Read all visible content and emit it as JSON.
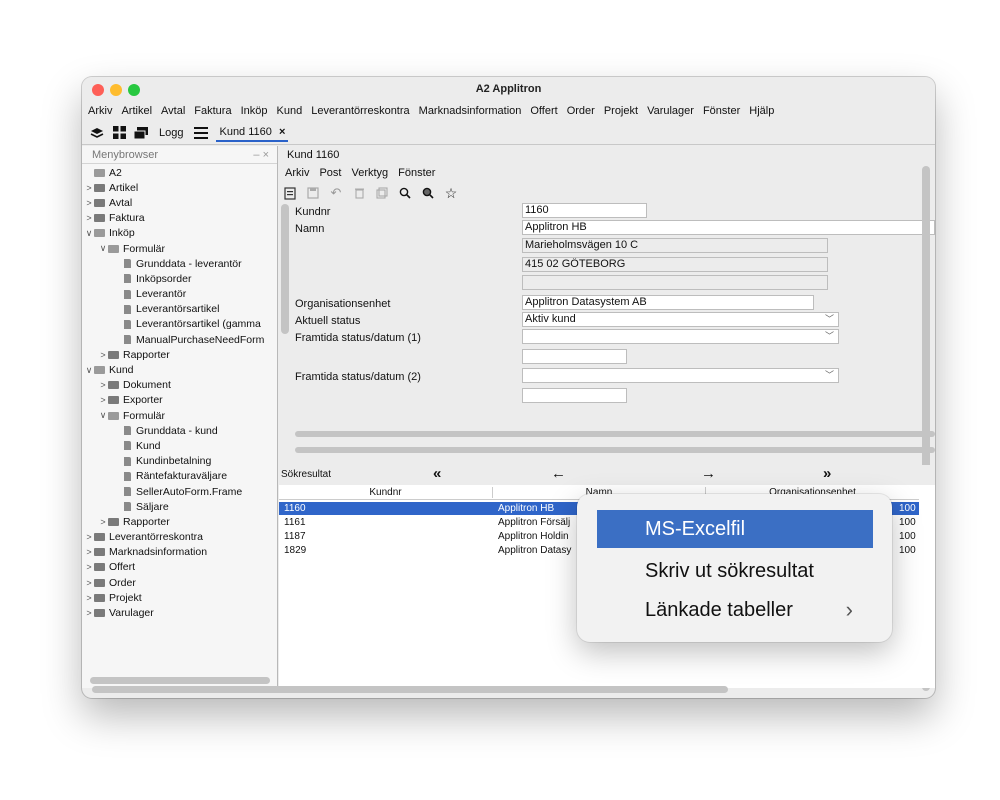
{
  "window": {
    "title": "A2 Applitron"
  },
  "menubar": [
    "Arkiv",
    "Artikel",
    "Avtal",
    "Faktura",
    "Inköp",
    "Kund",
    "Leverantörreskontra",
    "Marknadsinformation",
    "Offert",
    "Order",
    "Projekt",
    "Varulager",
    "Fönster",
    "Hjälp"
  ],
  "toolbar": {
    "tab_logg": "Logg",
    "tab_kund": "Kund 1160",
    "close": "×"
  },
  "sidebar": {
    "title": "Menybrowser",
    "controls": "–  ×",
    "items": [
      {
        "level": 0,
        "type": "folder-open",
        "chev": "",
        "label": "A2"
      },
      {
        "level": 0,
        "type": "folder",
        "chev": ">",
        "label": "Artikel"
      },
      {
        "level": 0,
        "type": "folder",
        "chev": ">",
        "label": "Avtal"
      },
      {
        "level": 0,
        "type": "folder",
        "chev": ">",
        "label": "Faktura"
      },
      {
        "level": 0,
        "type": "folder-open",
        "chev": "∨",
        "label": "Inköp"
      },
      {
        "level": 1,
        "type": "folder-open",
        "chev": "∨",
        "label": "Formulär"
      },
      {
        "level": 2,
        "type": "doc",
        "chev": "",
        "label": "Grunddata - leverantör"
      },
      {
        "level": 2,
        "type": "doc",
        "chev": "",
        "label": "Inköpsorder"
      },
      {
        "level": 2,
        "type": "doc",
        "chev": "",
        "label": "Leverantör"
      },
      {
        "level": 2,
        "type": "doc",
        "chev": "",
        "label": "Leverantörsartikel"
      },
      {
        "level": 2,
        "type": "doc",
        "chev": "",
        "label": "Leverantörsartikel (gamma"
      },
      {
        "level": 2,
        "type": "doc",
        "chev": "",
        "label": "ManualPurchaseNeedForm"
      },
      {
        "level": 1,
        "type": "folder",
        "chev": ">",
        "label": "Rapporter"
      },
      {
        "level": 0,
        "type": "folder-open",
        "chev": "∨",
        "label": "Kund"
      },
      {
        "level": 1,
        "type": "folder",
        "chev": ">",
        "label": "Dokument"
      },
      {
        "level": 1,
        "type": "folder",
        "chev": ">",
        "label": "Exporter"
      },
      {
        "level": 1,
        "type": "folder-open",
        "chev": "∨",
        "label": "Formulär"
      },
      {
        "level": 2,
        "type": "doc",
        "chev": "",
        "label": "Grunddata - kund"
      },
      {
        "level": 2,
        "type": "doc",
        "chev": "",
        "label": "Kund"
      },
      {
        "level": 2,
        "type": "doc",
        "chev": "",
        "label": "Kundinbetalning"
      },
      {
        "level": 2,
        "type": "doc",
        "chev": "",
        "label": "Räntefakturaväljare"
      },
      {
        "level": 2,
        "type": "doc",
        "chev": "",
        "label": "SellerAutoForm.Frame"
      },
      {
        "level": 2,
        "type": "doc",
        "chev": "",
        "label": "Säljare"
      },
      {
        "level": 1,
        "type": "folder",
        "chev": ">",
        "label": "Rapporter"
      },
      {
        "level": 0,
        "type": "folder",
        "chev": ">",
        "label": "Leverantörreskontra"
      },
      {
        "level": 0,
        "type": "folder",
        "chev": ">",
        "label": "Marknadsinformation"
      },
      {
        "level": 0,
        "type": "folder",
        "chev": ">",
        "label": "Offert"
      },
      {
        "level": 0,
        "type": "folder",
        "chev": ">",
        "label": "Order"
      },
      {
        "level": 0,
        "type": "folder",
        "chev": ">",
        "label": "Projekt"
      },
      {
        "level": 0,
        "type": "folder",
        "chev": ">",
        "label": "Varulager"
      }
    ]
  },
  "form": {
    "title": "Kund 1160",
    "menu": [
      "Arkiv",
      "Post",
      "Verktyg",
      "Fönster"
    ],
    "labels": {
      "kundnr": "Kundnr",
      "namn": "Namn",
      "org": "Organisationsenhet",
      "status": "Aktuell status",
      "framtida1": "Framtida status/datum (1)",
      "framtida2": "Framtida status/datum (2)"
    },
    "values": {
      "kundnr": "1160",
      "namn": "Applitron HB",
      "adress1": "Marieholmsvägen 10 C",
      "adress2": "415 02  GÖTEBORG",
      "adress3": "",
      "org": "Applitron Datasystem AB",
      "status": "Aktiv kund",
      "framtida1": "",
      "framtida1_datum": "",
      "framtida2": "",
      "framtida2_datum": ""
    }
  },
  "results": {
    "title": "Sökresultat",
    "nav": [
      "«",
      "←",
      "→",
      "»"
    ],
    "columns": [
      "Kundnr",
      "Namn",
      "Organisationsenhet"
    ],
    "rows": [
      {
        "kundnr": "1160",
        "namn": "Applitron HB",
        "org": "100"
      },
      {
        "kundnr": "1161",
        "namn": "Applitron Försälj",
        "org": "100"
      },
      {
        "kundnr": "1187",
        "namn": "Applitron Holdin",
        "org": "100"
      },
      {
        "kundnr": "1829",
        "namn": "Applitron Datasy",
        "org": "100"
      }
    ]
  },
  "popup": {
    "items": [
      "MS-Excelfil",
      "Skriv ut sökresultat",
      "Länkade tabeller"
    ],
    "submenu_arrow": "›"
  },
  "colors": {
    "accent": "#2f65c9",
    "popup_highlight": "#3b6fc4",
    "close": "#fe5f57",
    "minimize": "#febc2e",
    "zoom": "#28c840"
  }
}
